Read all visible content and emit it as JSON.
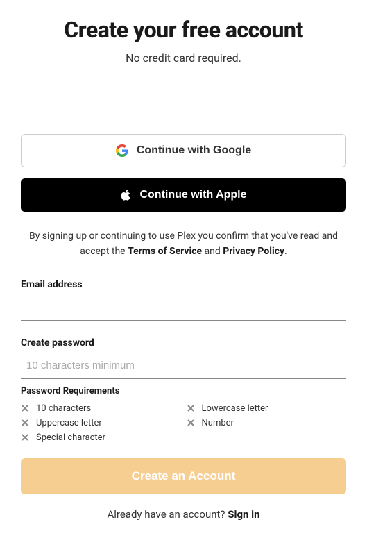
{
  "header": {
    "title": "Create your free account",
    "subtitle": "No credit card required."
  },
  "oauth": {
    "google_label": "Continue with Google",
    "apple_label": "Continue with Apple"
  },
  "legal": {
    "prefix": "By signing up or continuing to use Plex you confirm that you've read and accept the ",
    "tos": "Terms of Service",
    "and": " and ",
    "privacy": "Privacy Policy",
    "suffix": "."
  },
  "form": {
    "email_label": "Email address",
    "password_label": "Create password",
    "password_placeholder": "10 characters minimum"
  },
  "requirements": {
    "title": "Password Requirements",
    "items": {
      "len10": "10 characters",
      "lowercase": "Lowercase letter",
      "uppercase": "Uppercase letter",
      "number": "Number",
      "special": "Special character"
    }
  },
  "submit_label": "Create an Account",
  "footer": {
    "prompt": "Already have an account? ",
    "signin": "Sign in"
  }
}
